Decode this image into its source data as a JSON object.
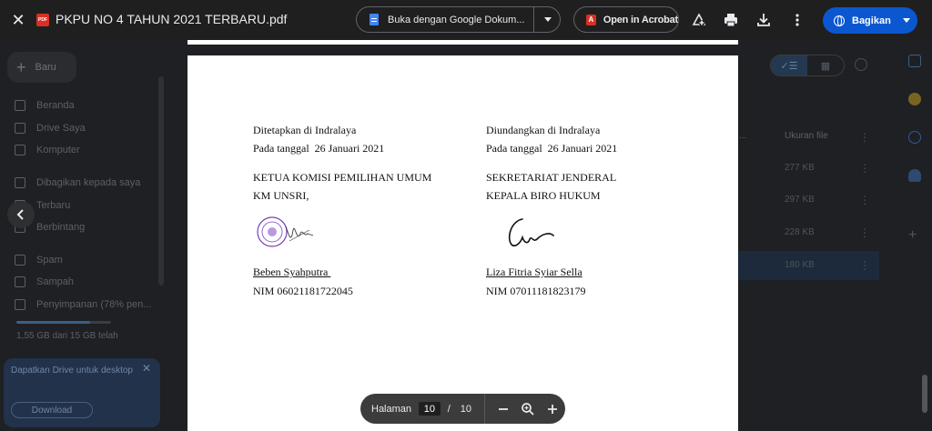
{
  "topbar": {
    "file_title": "PKPU NO 4 TAHUN 2021 TERBARU.pdf",
    "file_type_badge": "PDF",
    "open_with_label": "Buka dengan Google Dokum...",
    "acrobat_label": "Open in Acrobat",
    "share_label": "Bagikan",
    "icons": [
      "close-icon",
      "add-shortcut-icon",
      "print-icon",
      "download-icon",
      "more-vert-icon"
    ]
  },
  "drive_background": {
    "new_label": "Baru",
    "nav_items": [
      "Beranda",
      "Drive Saya",
      "Komputer",
      "Dibagikan kepada saya",
      "Terbaru",
      "Berbintang",
      "Spam",
      "Sampah",
      "Penyimpanan (78% pen..."
    ],
    "storage_fraction": 0.78,
    "storage_text": "1,55 GB dari 15 GB telah",
    "promo_text": "Dapatkan Drive untuk desktop",
    "promo_button": "Download",
    "column_owner_header": "...",
    "column_size_header": "Ukuran file",
    "file_sizes": [
      "277 KB",
      "297 KB",
      "228 KB",
      "180 KB"
    ]
  },
  "document": {
    "left": {
      "line1": "Ditetapkan di Indralaya",
      "line2": "Pada tanggal  26 Januari 2021",
      "title1": "KETUA KOMISI PEMILIHAN UMUM",
      "title2": "KM UNSRI,",
      "name": "Beben Syahputra ",
      "nim": "NIM 06021181722045"
    },
    "right": {
      "line1": "Diundangkan di Indralaya",
      "line2": "Pada tanggal  26 Januari 2021",
      "title1": "SEKRETARIAT JENDERAL",
      "title2": "KEPALA BIRO HUKUM",
      "name": "Liza Fitria Syiar Sella",
      "nim": "NIM 07011181823179"
    },
    "stamp_color": "#7b3fb5"
  },
  "pager": {
    "label": "Halaman",
    "current": "10",
    "separator": "/",
    "total": "10"
  },
  "colors": {
    "share_button": "#0b57d0",
    "acrobat_red": "#d93025",
    "docs_blue": "#4285f4"
  }
}
